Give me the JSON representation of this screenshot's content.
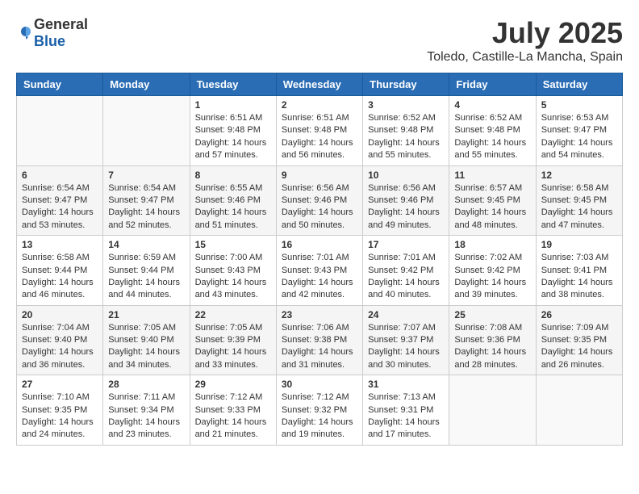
{
  "logo": {
    "general": "General",
    "blue": "Blue"
  },
  "title": {
    "month": "July 2025",
    "location": "Toledo, Castille-La Mancha, Spain"
  },
  "weekdays": [
    "Sunday",
    "Monday",
    "Tuesday",
    "Wednesday",
    "Thursday",
    "Friday",
    "Saturday"
  ],
  "weeks": [
    [
      {
        "day": "",
        "info": ""
      },
      {
        "day": "",
        "info": ""
      },
      {
        "day": "1",
        "info": "Sunrise: 6:51 AM\nSunset: 9:48 PM\nDaylight: 14 hours\nand 57 minutes."
      },
      {
        "day": "2",
        "info": "Sunrise: 6:51 AM\nSunset: 9:48 PM\nDaylight: 14 hours\nand 56 minutes."
      },
      {
        "day": "3",
        "info": "Sunrise: 6:52 AM\nSunset: 9:48 PM\nDaylight: 14 hours\nand 55 minutes."
      },
      {
        "day": "4",
        "info": "Sunrise: 6:52 AM\nSunset: 9:48 PM\nDaylight: 14 hours\nand 55 minutes."
      },
      {
        "day": "5",
        "info": "Sunrise: 6:53 AM\nSunset: 9:47 PM\nDaylight: 14 hours\nand 54 minutes."
      }
    ],
    [
      {
        "day": "6",
        "info": "Sunrise: 6:54 AM\nSunset: 9:47 PM\nDaylight: 14 hours\nand 53 minutes."
      },
      {
        "day": "7",
        "info": "Sunrise: 6:54 AM\nSunset: 9:47 PM\nDaylight: 14 hours\nand 52 minutes."
      },
      {
        "day": "8",
        "info": "Sunrise: 6:55 AM\nSunset: 9:46 PM\nDaylight: 14 hours\nand 51 minutes."
      },
      {
        "day": "9",
        "info": "Sunrise: 6:56 AM\nSunset: 9:46 PM\nDaylight: 14 hours\nand 50 minutes."
      },
      {
        "day": "10",
        "info": "Sunrise: 6:56 AM\nSunset: 9:46 PM\nDaylight: 14 hours\nand 49 minutes."
      },
      {
        "day": "11",
        "info": "Sunrise: 6:57 AM\nSunset: 9:45 PM\nDaylight: 14 hours\nand 48 minutes."
      },
      {
        "day": "12",
        "info": "Sunrise: 6:58 AM\nSunset: 9:45 PM\nDaylight: 14 hours\nand 47 minutes."
      }
    ],
    [
      {
        "day": "13",
        "info": "Sunrise: 6:58 AM\nSunset: 9:44 PM\nDaylight: 14 hours\nand 46 minutes."
      },
      {
        "day": "14",
        "info": "Sunrise: 6:59 AM\nSunset: 9:44 PM\nDaylight: 14 hours\nand 44 minutes."
      },
      {
        "day": "15",
        "info": "Sunrise: 7:00 AM\nSunset: 9:43 PM\nDaylight: 14 hours\nand 43 minutes."
      },
      {
        "day": "16",
        "info": "Sunrise: 7:01 AM\nSunset: 9:43 PM\nDaylight: 14 hours\nand 42 minutes."
      },
      {
        "day": "17",
        "info": "Sunrise: 7:01 AM\nSunset: 9:42 PM\nDaylight: 14 hours\nand 40 minutes."
      },
      {
        "day": "18",
        "info": "Sunrise: 7:02 AM\nSunset: 9:42 PM\nDaylight: 14 hours\nand 39 minutes."
      },
      {
        "day": "19",
        "info": "Sunrise: 7:03 AM\nSunset: 9:41 PM\nDaylight: 14 hours\nand 38 minutes."
      }
    ],
    [
      {
        "day": "20",
        "info": "Sunrise: 7:04 AM\nSunset: 9:40 PM\nDaylight: 14 hours\nand 36 minutes."
      },
      {
        "day": "21",
        "info": "Sunrise: 7:05 AM\nSunset: 9:40 PM\nDaylight: 14 hours\nand 34 minutes."
      },
      {
        "day": "22",
        "info": "Sunrise: 7:05 AM\nSunset: 9:39 PM\nDaylight: 14 hours\nand 33 minutes."
      },
      {
        "day": "23",
        "info": "Sunrise: 7:06 AM\nSunset: 9:38 PM\nDaylight: 14 hours\nand 31 minutes."
      },
      {
        "day": "24",
        "info": "Sunrise: 7:07 AM\nSunset: 9:37 PM\nDaylight: 14 hours\nand 30 minutes."
      },
      {
        "day": "25",
        "info": "Sunrise: 7:08 AM\nSunset: 9:36 PM\nDaylight: 14 hours\nand 28 minutes."
      },
      {
        "day": "26",
        "info": "Sunrise: 7:09 AM\nSunset: 9:35 PM\nDaylight: 14 hours\nand 26 minutes."
      }
    ],
    [
      {
        "day": "27",
        "info": "Sunrise: 7:10 AM\nSunset: 9:35 PM\nDaylight: 14 hours\nand 24 minutes."
      },
      {
        "day": "28",
        "info": "Sunrise: 7:11 AM\nSunset: 9:34 PM\nDaylight: 14 hours\nand 23 minutes."
      },
      {
        "day": "29",
        "info": "Sunrise: 7:12 AM\nSunset: 9:33 PM\nDaylight: 14 hours\nand 21 minutes."
      },
      {
        "day": "30",
        "info": "Sunrise: 7:12 AM\nSunset: 9:32 PM\nDaylight: 14 hours\nand 19 minutes."
      },
      {
        "day": "31",
        "info": "Sunrise: 7:13 AM\nSunset: 9:31 PM\nDaylight: 14 hours\nand 17 minutes."
      },
      {
        "day": "",
        "info": ""
      },
      {
        "day": "",
        "info": ""
      }
    ]
  ]
}
